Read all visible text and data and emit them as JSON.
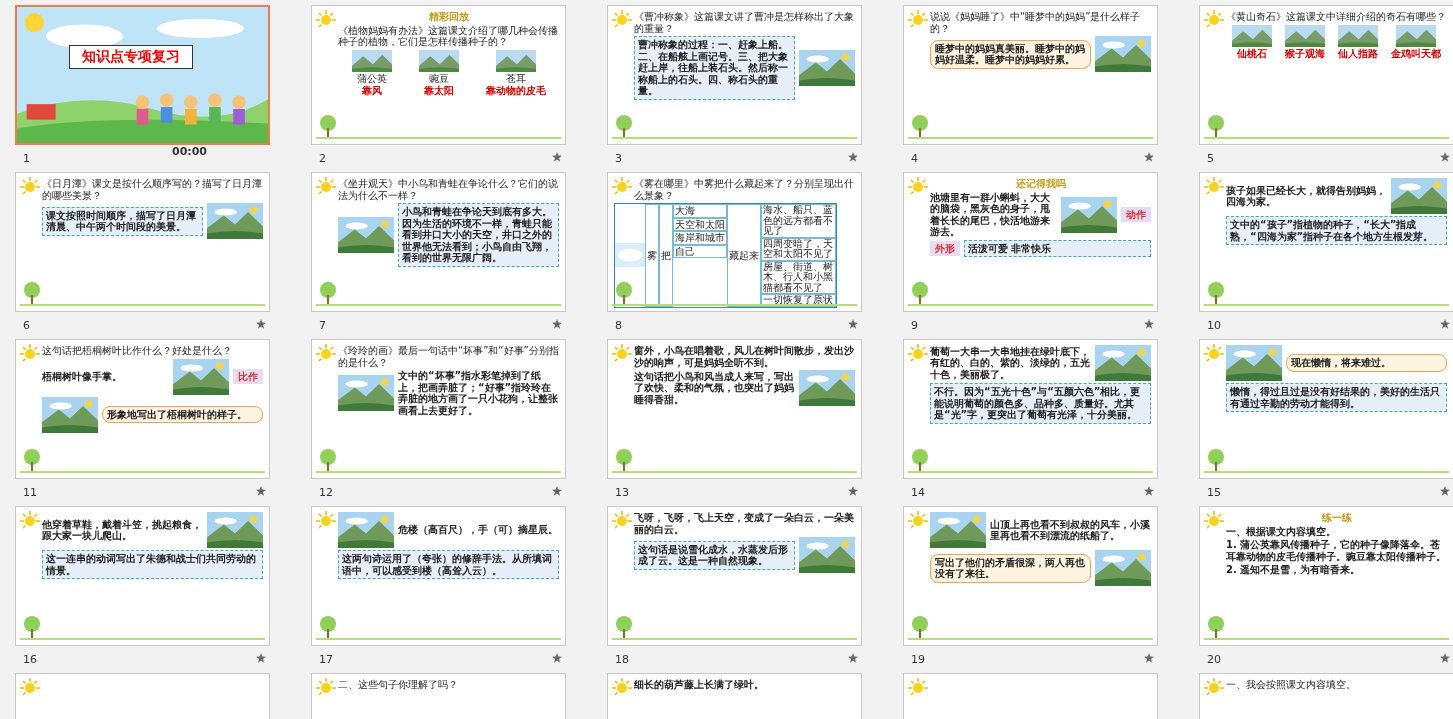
{
  "slides": [
    {
      "number": "1",
      "selected": true,
      "timing": "00:00",
      "animated": false,
      "kind": "cover",
      "items": [
        {
          "kind": "cover_title",
          "text": "知识点专项复习"
        }
      ]
    },
    {
      "number": "2",
      "selected": false,
      "animated": true,
      "kind": "content",
      "items": [
        {
          "kind": "heading",
          "text": "精彩回放"
        },
        {
          "kind": "title",
          "text": "《植物妈妈有办法》这篇课文介绍了哪几种会传播种子的植物，它们是怎样传播种子的？"
        },
        {
          "kind": "figures",
          "figures": [
            {
              "caption": "蒲公英",
              "label": "靠风"
            },
            {
              "caption": "豌豆",
              "label": "靠太阳"
            },
            {
              "caption": "苍耳",
              "label": "靠动物的皮毛"
            }
          ]
        }
      ]
    },
    {
      "number": "3",
      "selected": false,
      "animated": true,
      "kind": "content",
      "items": [
        {
          "kind": "title",
          "text": "《曹冲称象》这篇课文讲了曹冲是怎样称出了大象的重量？"
        },
        {
          "kind": "note",
          "text": "曹冲称象的过程：**一、**赶象上船。**二、**在船舷上画记号。**三、**把大象赶上岸，往船上装石头。然后称一称船上的石头。**四、**称石头的重量。"
        },
        {
          "kind": "picture"
        }
      ]
    },
    {
      "number": "4",
      "selected": false,
      "animated": true,
      "kind": "content",
      "items": [
        {
          "kind": "title",
          "text": "说说《妈妈睡了》中“睡梦中的妈妈”是什么样子的？"
        },
        {
          "kind": "bubble",
          "text": "睡梦中的妈妈真美丽。睡梦中的妈妈好温柔。睡梦中的妈妈好累。"
        },
        {
          "kind": "picture"
        }
      ]
    },
    {
      "number": "5",
      "selected": false,
      "animated": true,
      "kind": "content",
      "items": [
        {
          "kind": "title",
          "text": "《黄山奇石》这篇课文中详细介绍的奇石有哪些？"
        },
        {
          "kind": "figures",
          "figures": [
            {
              "label": "仙桃石"
            },
            {
              "label": "猴子观海"
            },
            {
              "label": "仙人指路"
            },
            {
              "label": "金鸡叫天都"
            }
          ]
        }
      ]
    },
    {
      "number": "6",
      "selected": false,
      "animated": true,
      "kind": "content",
      "items": [
        {
          "kind": "title",
          "text": "《日月潭》课文是按什么顺序写的？描写了日月潭的哪些美景？"
        },
        {
          "kind": "note",
          "text": "课文按照**时间顺序**，描写了日月潭**清晨**、**中午**两个时间段的美景。"
        },
        {
          "kind": "picture"
        }
      ]
    },
    {
      "number": "7",
      "selected": false,
      "animated": true,
      "kind": "content",
      "items": [
        {
          "kind": "title",
          "text": "《坐井观天》中小鸟和青蛙在争论什么？它们的说法为什么不一样？"
        },
        {
          "kind": "picture"
        },
        {
          "kind": "note",
          "text": "小鸟和青蛙在争论天到底有多大。因为生活的环境不一样，青蛙只能看到井口大小的天空，井口之外的世界他无法看到；小鸟自由飞翔，看到的世界无限广阔。"
        }
      ]
    },
    {
      "number": "8",
      "selected": false,
      "animated": true,
      "kind": "content",
      "items": [
        {
          "kind": "title",
          "text": "《雾在哪里》中雾把什么藏起来了？分别呈现出什么景象？"
        },
        {
          "kind": "table",
          "subject": "雾",
          "verb": "把",
          "action": "藏起来",
          "rows": [
            {
              "object": "大海",
              "result": "海水、船只、蓝色的远方都看不见了"
            },
            {
              "object": "天空和太阳",
              "result": "四周变暗了，天空和太阳不见了"
            },
            {
              "object": "海岸和城市",
              "result": "房屋、街道、树木、行人和小黑猫都看不见了"
            },
            {
              "object": "自己",
              "result": "一切恢复了原状"
            }
          ]
        }
      ]
    },
    {
      "number": "9",
      "selected": false,
      "animated": true,
      "kind": "content",
      "items": [
        {
          "kind": "heading",
          "text": "还记得我吗"
        },
        {
          "kind": "text",
          "text": "池塘里有一群小蝌蚪，大大的脑袋，黑灰色的身子，甩着长长的尾巴，快活地游来游去。"
        },
        {
          "kind": "picture"
        },
        {
          "kind": "tag",
          "text": "动作"
        },
        {
          "kind": "tag",
          "text": "外形"
        },
        {
          "kind": "note",
          "text": "活泼可爱 非常快乐"
        }
      ]
    },
    {
      "number": "10",
      "selected": false,
      "animated": true,
      "kind": "content",
      "items": [
        {
          "kind": "text",
          "text": "孩子如果已经长大，就得告别妈妈，四海为家。"
        },
        {
          "kind": "picture"
        },
        {
          "kind": "note",
          "text": "文中的“孩子”指**植物的种子**，“长大”指**成熟**，“四海为家”指**种子在各个地方生根发芽**。"
        }
      ]
    },
    {
      "number": "11",
      "selected": false,
      "animated": true,
      "kind": "content",
      "items": [
        {
          "kind": "title",
          "text": "这句话把梧桐树叶比作什么？好处是什么？"
        },
        {
          "kind": "text",
          "text": "梧桐树叶像手掌。"
        },
        {
          "kind": "picture"
        },
        {
          "kind": "tag",
          "text": "比作"
        },
        {
          "kind": "picture"
        },
        {
          "kind": "bubble",
          "text": "形象地写出了梧桐树叶的样子。"
        }
      ]
    },
    {
      "number": "12",
      "selected": false,
      "animated": true,
      "kind": "content",
      "items": [
        {
          "kind": "title",
          "text": "《玲玲的画》最后一句话中“坏事”和“好事”分别指的是什么？"
        },
        {
          "kind": "picture"
        },
        {
          "kind": "text",
          "text": "文中的“坏事”指水彩笔掉到了纸上，把画弄脏了；“好事”指玲玲在弄脏的地方画了一只小花狗，让整张画看上去更好了。"
        }
      ]
    },
    {
      "number": "13",
      "selected": false,
      "animated": true,
      "kind": "content",
      "items": [
        {
          "kind": "text",
          "text": "窗外，小鸟在唱着歌，风儿在树叶间散步，发出沙沙的响声，可是妈妈全听不到。"
        },
        {
          "kind": "text",
          "text": "这句话把小鸟和风当成**人**来写，写出了**欢快**、**柔和**的气氛，也突出了**妈妈睡得香甜**。"
        },
        {
          "kind": "picture"
        }
      ]
    },
    {
      "number": "14",
      "selected": false,
      "animated": true,
      "kind": "content",
      "items": [
        {
          "kind": "text",
          "text": "葡萄一大串一大串地挂在绿叶底下，有红的、白的、紫的、淡绿的，**五光十色**，美丽极了。"
        },
        {
          "kind": "picture"
        },
        {
          "kind": "note",
          "text": "不行。因为“五光十色”与“五颜六色”相比，更能说明葡萄的颜色多、品种多、质量好。尤其是“光”字，更突出了葡萄有光泽，十分美丽。"
        }
      ]
    },
    {
      "number": "15",
      "selected": false,
      "animated": true,
      "kind": "content",
      "items": [
        {
          "kind": "picture"
        },
        {
          "kind": "bubble",
          "text": "现在懒惰，将来难过。"
        },
        {
          "kind": "note",
          "text": "懒惰，得过且过是没有好结果的，美好的生活只有通过辛勤的劳动才能得到。"
        }
      ]
    },
    {
      "number": "16",
      "selected": false,
      "animated": true,
      "kind": "content",
      "items": [
        {
          "kind": "text",
          "text": "他穿着草鞋，**戴着**斗笠，**挑起**粮食，跟大家一块儿爬山。"
        },
        {
          "kind": "picture"
        },
        {
          "kind": "note",
          "text": "这一连串的动词写出了朱德和战士们共同劳动的情景。"
        }
      ]
    },
    {
      "number": "17",
      "selected": false,
      "animated": true,
      "kind": "content",
      "items": [
        {
          "kind": "picture"
        },
        {
          "kind": "text",
          "text": "危楼（**高百尺**），手（**可**）摘星辰。"
        },
        {
          "kind": "note",
          "text": "这两句诗运用了（**夸张**）的修辞手法。从所填词语中，可以感受到楼（**高耸入云**）。"
        }
      ]
    },
    {
      "number": "18",
      "selected": false,
      "animated": true,
      "kind": "content",
      "items": [
        {
          "kind": "text",
          "text": "飞呀，飞呀，飞上天空，变成了一朵白云，一朵美丽的白云。"
        },
        {
          "kind": "note",
          "text": "这句话是说雪化成水，水蒸发后形成了云。这是一种自然现象。"
        },
        {
          "kind": "picture"
        }
      ]
    },
    {
      "number": "19",
      "selected": false,
      "animated": true,
      "kind": "content",
      "items": [
        {
          "kind": "picture"
        },
        {
          "kind": "text",
          "text": "山顶上再也看不到叔叔的风车，小溪里再也看不到漂流的纸船了。"
        },
        {
          "kind": "bubble",
          "text": "写出了他们的矛盾很深，两人再也没有了来往。"
        },
        {
          "kind": "picture"
        }
      ]
    },
    {
      "number": "20",
      "selected": false,
      "animated": true,
      "kind": "content",
      "items": [
        {
          "kind": "heading",
          "text": "练一练"
        },
        {
          "kind": "text",
          "text": "一、根据课文内容填空。"
        },
        {
          "kind": "text",
          "text": "1. 蒲公英靠**风**传播种子，它的种子像**降落伞**。苍耳靠**动物的皮毛**传播种子。豌豆靠**太阳**传播种子。"
        },
        {
          "kind": "text",
          "text": "2. 遥知不是雪，**为有暗香来**。"
        }
      ]
    },
    {
      "selected": false,
      "kind": "content"
    },
    {
      "selected": false,
      "kind": "content",
      "items": [
        {
          "kind": "title",
          "text": "二、这些句子你理解了吗？"
        }
      ]
    },
    {
      "selected": false,
      "kind": "content",
      "items": [
        {
          "kind": "text",
          "text": "细长的葫芦藤上长满了绿叶。"
        }
      ]
    },
    {
      "selected": false,
      "kind": "content"
    },
    {
      "selected": false,
      "kind": "content",
      "items": [
        {
          "kind": "title",
          "text": "一、我会按照课文内容填空。"
        }
      ]
    }
  ]
}
